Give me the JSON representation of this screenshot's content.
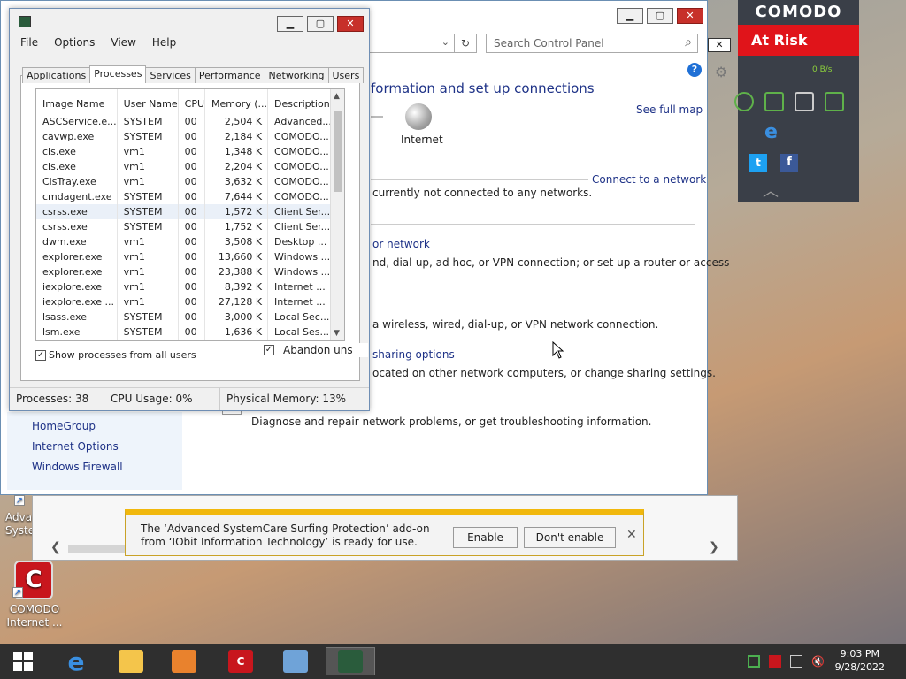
{
  "desktop": {
    "icons": [
      {
        "label": "Adva\nSyster"
      },
      {
        "label": "COMODO\nInternet ..."
      }
    ]
  },
  "control_panel": {
    "search_placeholder": "Search Control Panel",
    "heading": "formation and set up connections",
    "internet_label": "Internet",
    "see_full_map": "See full map",
    "connect_to_network": "Connect to a network",
    "lines": [
      "currently not connected to any networks.",
      "or network",
      "nd, dial-up, ad hoc, or VPN connection; or set up a router or access",
      "a wireless, wired, dial-up, or VPN network connection.",
      "sharing options",
      "ocated on other network computers, or change sharing settings.",
      "Diagnose and repair network problems, or get troubleshooting information."
    ],
    "sidebar": [
      "HomeGroup",
      "Internet Options",
      "Windows Firewall"
    ]
  },
  "notification": {
    "message": "The ‘Advanced SystemCare Surfing Protection’ add-on from ‘IObit Information Technology’ is ready for use.",
    "enable": "Enable",
    "dont_enable": "Don't enable",
    "close": "✕"
  },
  "task_manager": {
    "menu": [
      "File",
      "Options",
      "View",
      "Help"
    ],
    "tabs": [
      "Applications",
      "Processes",
      "Services",
      "Performance",
      "Networking",
      "Users"
    ],
    "active_tab": "Processes",
    "columns": [
      "Image Name",
      "User Name",
      "CPU",
      "Memory (...",
      "Description"
    ],
    "rows": [
      [
        "ASCService.e...",
        "SYSTEM",
        "00",
        "2,504 K",
        "Advanced..."
      ],
      [
        "cavwp.exe",
        "SYSTEM",
        "00",
        "2,184 K",
        "COMODO..."
      ],
      [
        "cis.exe",
        "vm1",
        "00",
        "1,348 K",
        "COMODO..."
      ],
      [
        "cis.exe",
        "vm1",
        "00",
        "2,204 K",
        "COMODO..."
      ],
      [
        "CisTray.exe",
        "vm1",
        "00",
        "3,632 K",
        "COMODO..."
      ],
      [
        "cmdagent.exe",
        "SYSTEM",
        "00",
        "7,644 K",
        "COMODO..."
      ],
      [
        "csrss.exe",
        "SYSTEM",
        "00",
        "1,572 K",
        "Client Ser..."
      ],
      [
        "csrss.exe",
        "SYSTEM",
        "00",
        "1,752 K",
        "Client Ser..."
      ],
      [
        "dwm.exe",
        "vm1",
        "00",
        "3,508 K",
        "Desktop ..."
      ],
      [
        "explorer.exe",
        "vm1",
        "00",
        "13,660 K",
        "Windows ..."
      ],
      [
        "explorer.exe",
        "vm1",
        "00",
        "23,388 K",
        "Windows ..."
      ],
      [
        "iexplore.exe",
        "vm1",
        "00",
        "8,392 K",
        "Internet ..."
      ],
      [
        "iexplore.exe ...",
        "vm1",
        "00",
        "27,128 K",
        "Internet ..."
      ],
      [
        "lsass.exe",
        "SYSTEM",
        "00",
        "3,000 K",
        "Local Sec..."
      ],
      [
        "lsm.exe",
        "SYSTEM",
        "00",
        "1,636 K",
        "Local Ses..."
      ]
    ],
    "selected_row": 6,
    "show_all_label": "Show processes from all users",
    "show_all_checked": true,
    "status": {
      "processes": "Processes: 38",
      "cpu": "CPU Usage: 0%",
      "memory": "Physical Memory: 13%"
    }
  },
  "abandon_label": "Abandon uns",
  "comodo": {
    "brand": "COMODO",
    "status": "At Risk",
    "rate": "0 B/s"
  },
  "taskbar": {
    "time": "9:03 PM",
    "date": "9/28/2022"
  },
  "colors": {
    "risk": "#e0141a",
    "notify_accent": "#f1b80d",
    "link": "#1e3287"
  }
}
